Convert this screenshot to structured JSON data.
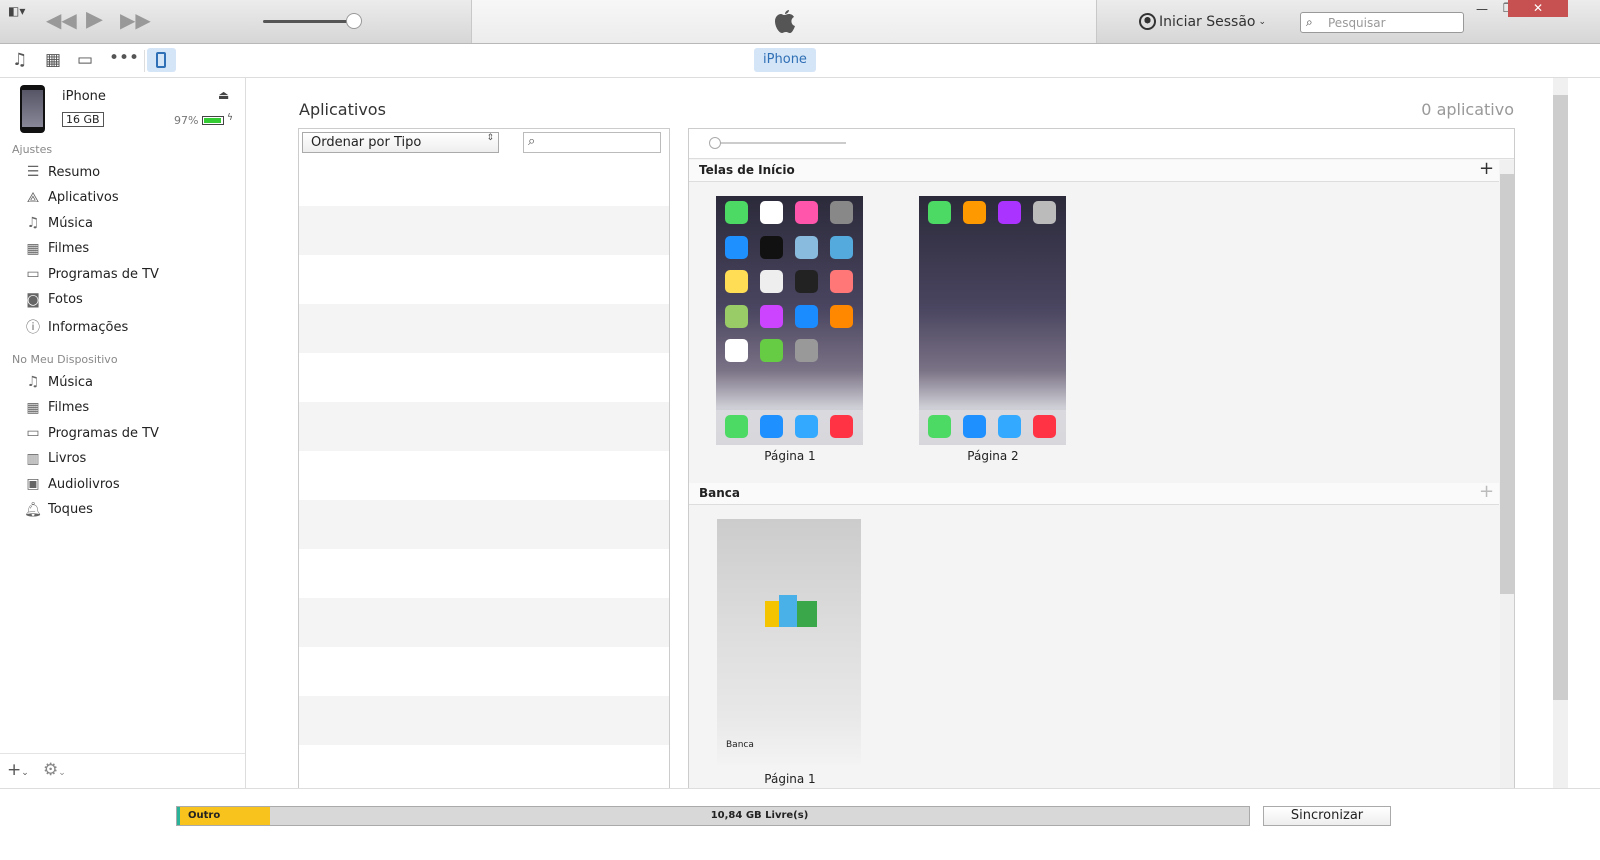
{
  "window": {
    "account_label": "Iniciar Sessão",
    "search_placeholder": "Pesquisar",
    "minimize": "—",
    "restore": "❐",
    "close": "✕"
  },
  "toolbar": {
    "device_tab": "iPhone",
    "icons": [
      "music-icon",
      "film-icon",
      "tv-icon",
      "more-icon",
      "iphone-icon"
    ]
  },
  "device": {
    "name": "iPhone",
    "capacity": "16 GB",
    "battery": "97%",
    "battery_level": 0.97
  },
  "sidebar": {
    "section_settings": "Ajustes",
    "settings_items": [
      {
        "label": "Resumo",
        "icon": "list-icon"
      },
      {
        "label": "Aplicativos",
        "icon": "apps-icon"
      },
      {
        "label": "Música",
        "icon": "music-icon"
      },
      {
        "label": "Filmes",
        "icon": "film-icon"
      },
      {
        "label": "Programas de TV",
        "icon": "tv-icon"
      },
      {
        "label": "Fotos",
        "icon": "camera-icon"
      },
      {
        "label": "Informações",
        "icon": "info-icon"
      }
    ],
    "section_device": "No Meu Dispositivo",
    "device_items": [
      {
        "label": "Música",
        "icon": "music-icon"
      },
      {
        "label": "Filmes",
        "icon": "film-icon"
      },
      {
        "label": "Programas de TV",
        "icon": "tv-icon"
      },
      {
        "label": "Livros",
        "icon": "book-icon"
      },
      {
        "label": "Audiolivros",
        "icon": "audiobook-icon"
      },
      {
        "label": "Toques",
        "icon": "bell-icon"
      }
    ]
  },
  "main": {
    "title": "Aplicativos",
    "count": "0 aplicativo",
    "sort_select": "Ordenar por Tipo",
    "home_screens": {
      "title": "Telas de Início",
      "pages": [
        "Página 1",
        "Página 2"
      ]
    },
    "newsstand": {
      "title": "Banca",
      "folder_label": "Banca",
      "pages": [
        "Página 1"
      ]
    }
  },
  "footer": {
    "storage": [
      {
        "label": "Outro",
        "color": "#f8c31c"
      },
      {
        "label": "10,84 GB Livre(s)",
        "color": "#d8d8d8"
      }
    ],
    "sync_button": "Sincronizar"
  }
}
